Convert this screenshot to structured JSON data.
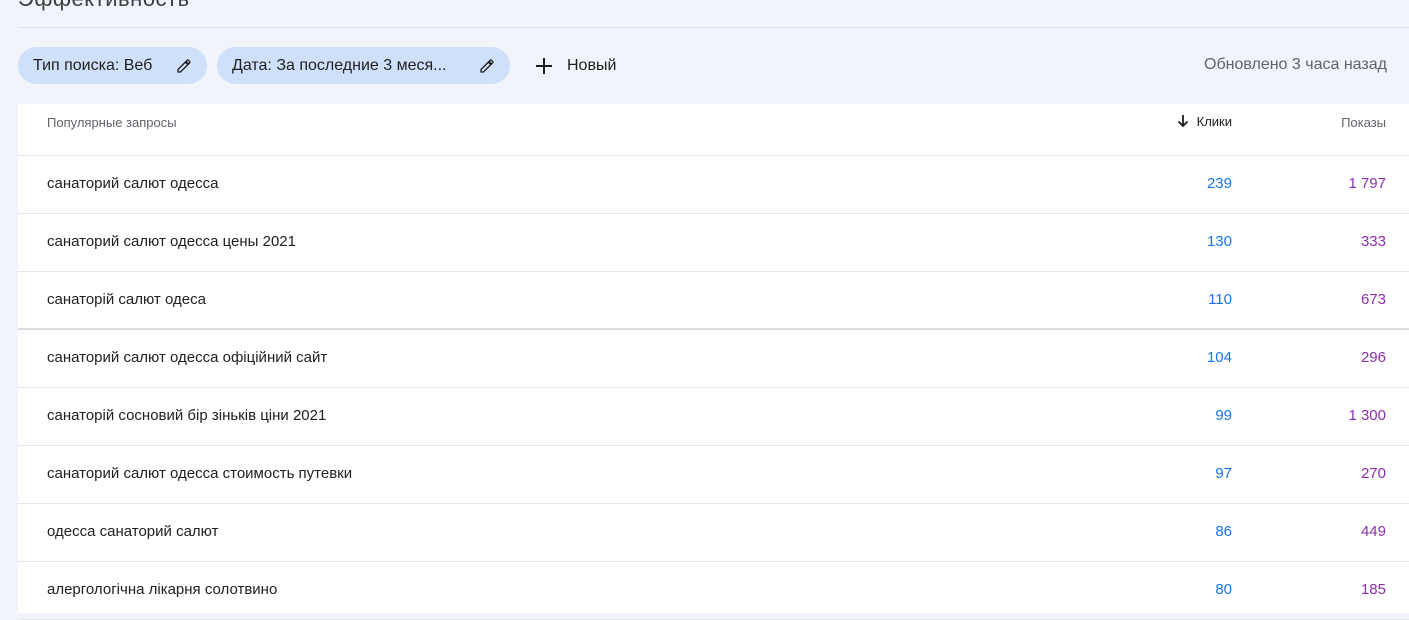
{
  "header": {
    "cutoff_title": "Эффективность"
  },
  "filters": {
    "search_type": "Тип поиска: Веб",
    "date": "Дата: За последние 3 меся...",
    "new_label": "Новый"
  },
  "status": {
    "updated": "Обновлено 3 часа назад"
  },
  "table": {
    "columns": {
      "query": "Популярные запросы",
      "clicks": "Клики",
      "impressions": "Показы"
    },
    "rows": [
      {
        "query": "санаторий салют одесса",
        "clicks": "239",
        "impressions": "1 797"
      },
      {
        "query": "санаторий салют одесса цены 2021",
        "clicks": "130",
        "impressions": "333"
      },
      {
        "query": "санаторій салют одеса",
        "clicks": "110",
        "impressions": "673"
      },
      {
        "query": "санаторий салют одесса офіційний сайт",
        "clicks": "104",
        "impressions": "296"
      },
      {
        "query": "санаторій сосновий бір зіньків ціни 2021",
        "clicks": "99",
        "impressions": "1 300"
      },
      {
        "query": "санаторий салют одесса стоимость путевки",
        "clicks": "97",
        "impressions": "270"
      },
      {
        "query": "одесса санаторий салют",
        "clicks": "86",
        "impressions": "449"
      },
      {
        "query": "алергологічна лікарня солотвино",
        "clicks": "80",
        "impressions": "185"
      }
    ]
  },
  "colors": {
    "clicks": "#1a73e8",
    "impressions": "#8b2fae",
    "chip_bg": "#cfe1fa",
    "page_bg": "#f1f4fb"
  },
  "icons": {
    "edit": "pencil-icon",
    "add": "plus-icon",
    "sort": "arrow-down-icon"
  }
}
